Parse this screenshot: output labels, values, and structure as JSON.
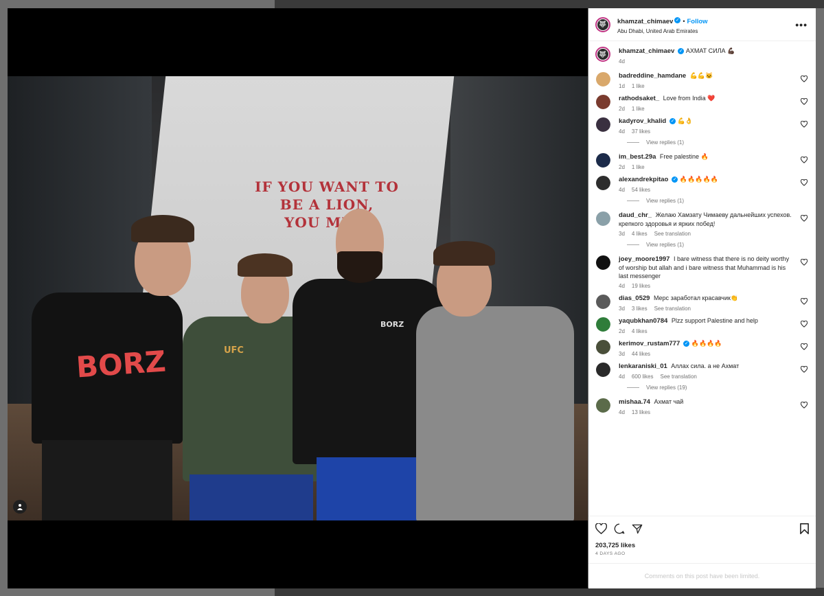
{
  "post": {
    "author": "khamzat_chimaev",
    "follow_label": "Follow",
    "dot": "•",
    "location": "Abu Dhabi, United Arab Emirates",
    "more_label": "•••",
    "verified_mark": "✓"
  },
  "photo": {
    "banner_line1": "IF YOU WANT TO",
    "banner_line2": "BE A LION,",
    "banner_line3": "YOU MU...",
    "shirt1": "BORZ",
    "shirt2": "UFC",
    "shirt3": "BORZ",
    "user_tag_icon": "user-tag-icon"
  },
  "caption": {
    "username": "khamzat_chimaev",
    "text": "АХМАТ СИЛА 💪🏿",
    "time": "4d"
  },
  "comments": [
    {
      "username": "badreddine_hamdane",
      "verified": false,
      "text": "💪💪🐱",
      "time": "1d",
      "likes": "1 like",
      "translation": "",
      "avatar_color": "#d9a86b"
    },
    {
      "username": "rathodsaket_",
      "verified": false,
      "text": "Love from India ❤️",
      "time": "2d",
      "likes": "1 like",
      "translation": "",
      "avatar_color": "#7a3b2e"
    },
    {
      "username": "kadyrov_khalid",
      "verified": true,
      "text": "💪👌",
      "time": "4d",
      "likes": "37 likes",
      "translation": "",
      "avatar_color": "#3a3040",
      "replies": "View replies (1)"
    },
    {
      "username": "im_best.29a",
      "verified": false,
      "text": "Free palestine 🔥",
      "time": "2d",
      "likes": "1 like",
      "translation": "",
      "avatar_color": "#1c2b4a"
    },
    {
      "username": "alexandrekpitao",
      "verified": true,
      "text": "🔥🔥🔥🔥🔥",
      "time": "4d",
      "likes": "54 likes",
      "translation": "",
      "avatar_color": "#2d2d2d",
      "replies": "View replies (1)"
    },
    {
      "username": "daud_chr_",
      "verified": false,
      "text": "Желаю Хамзату Чимаеву дальнейших успехов. крепкого здоровья и ярких побед!",
      "time": "3d",
      "likes": "4 likes",
      "translation": "See translation",
      "avatar_color": "#8aa0a8",
      "replies": "View replies (1)"
    },
    {
      "username": "joey_moore1997",
      "verified": false,
      "text": "I bare witness that there is no deity worthy of worship but allah and i bare witness that Muhammad is his last messenger",
      "time": "4d",
      "likes": "19 likes",
      "translation": "",
      "avatar_color": "#111111"
    },
    {
      "username": "dias_0529",
      "verified": false,
      "text": "Мерс заработал красавчик👏",
      "time": "3d",
      "likes": "3 likes",
      "translation": "See translation",
      "avatar_color": "#5a5a5a"
    },
    {
      "username": "yaqubkhan0784",
      "verified": false,
      "text": "Plzz support Palestine and help",
      "time": "2d",
      "likes": "4 likes",
      "translation": "",
      "avatar_color": "#2f7d3a"
    },
    {
      "username": "kerimov_rustam777",
      "verified": true,
      "text": "🔥🔥🔥🔥",
      "time": "3d",
      "likes": "44 likes",
      "translation": "",
      "avatar_color": "#4a4f3a"
    },
    {
      "username": "lenkaraniski_01",
      "verified": false,
      "text": "Аллах сила. а не Ахмат",
      "time": "4d",
      "likes": "600 likes",
      "translation": "See translation",
      "avatar_color": "#2a2a2a",
      "replies": "View replies (19)"
    },
    {
      "username": "mishaa.74",
      "verified": false,
      "text": "Ахмат чай",
      "time": "4d",
      "likes": "13 likes",
      "translation": "",
      "avatar_color": "#5b6b4a"
    }
  ],
  "actions": {
    "like_icon": "heart-icon",
    "comment_icon": "comment-icon",
    "share_icon": "share-icon",
    "save_icon": "bookmark-icon",
    "likes_count": "203,725 likes",
    "date": "4 DAYS AGO"
  },
  "footer": {
    "limited_text": "Comments on this post have been limited."
  }
}
